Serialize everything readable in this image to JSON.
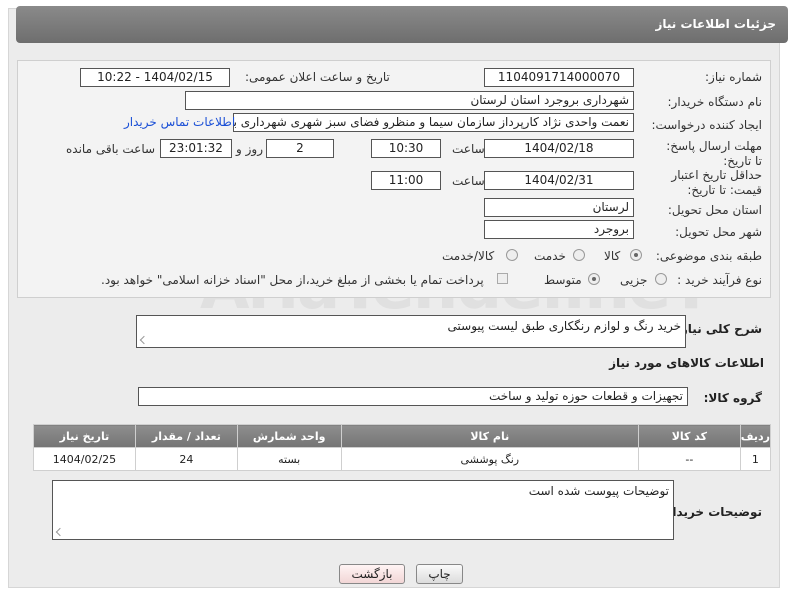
{
  "header": {
    "title": "جزئیات اطلاعات نیاز"
  },
  "form": {
    "need_number_label": "شماره نیاز:",
    "need_number": "1104091714000070",
    "announce_label": "تاریخ و ساعت اعلان عمومی:",
    "announce_value": "1404/02/15 - 10:22",
    "buyer_org_label": "نام دستگاه خریدار:",
    "buyer_org": "شهرداری بروجرد استان لرستان",
    "creator_label": "ایجاد کننده درخواست:",
    "creator": "نعمت واحدی نژاد کارپرداز سازمان سیما و منظرو فضای سبز شهری شهرداری بر",
    "contact_link": "اطلاعات تماس خریدار",
    "reply_deadline_label": "مهلت ارسال پاسخ: تا تاریخ:",
    "reply_date": "1404/02/18",
    "hour_label": "ساعت",
    "reply_time": "10:30",
    "days_value": "2",
    "days_label": "روز و",
    "remaining_time": "23:01:32",
    "remaining_label": "ساعت باقی مانده",
    "price_deadline_label": "حداقل تاریخ اعتبار قیمت: تا تاریخ:",
    "price_date": "1404/02/31",
    "price_time": "11:00",
    "province_label": "استان محل تحویل:",
    "province": "لرستان",
    "city_label": "شهر محل تحویل:",
    "city": "بروجرد",
    "category_label": "طبقه بندی موضوعی:",
    "cat_goods": "کالا",
    "cat_service": "خدمت",
    "cat_goods_service": "کالا/خدمت",
    "process_label": "نوع فرآیند خرید :",
    "proc_minor": "جزیی",
    "proc_medium": "متوسط",
    "payment_note": "پرداخت تمام یا بخشی از مبلغ خرید،از محل \"اسناد خزانه اسلامی\" خواهد بود."
  },
  "description": {
    "label": "شرح کلی نیاز:",
    "value": "خرید رنگ و لوازم رنگکاری طبق لیست پیوستی"
  },
  "goods_section": {
    "title": "اطلاعات کالاهای مورد نیاز",
    "group_label": "گروه کالا:",
    "group_value": "تجهیزات و قطعات حوزه تولید و ساخت"
  },
  "table": {
    "headers": [
      "ردیف",
      "کد کالا",
      "نام کالا",
      "واحد شمارش",
      "تعداد / مقدار",
      "تاریخ نیاز"
    ],
    "rows": [
      [
        "1",
        "--",
        "رنگ پوششی",
        "بسته",
        "24",
        "1404/02/25"
      ]
    ]
  },
  "buyer_notes": {
    "label": "توضیحات خریدار:",
    "value": "توضیحات پیوست شده است"
  },
  "buttons": {
    "print": "چاپ",
    "back": "بازگشت"
  },
  "watermark": "AriaTender.neT"
}
